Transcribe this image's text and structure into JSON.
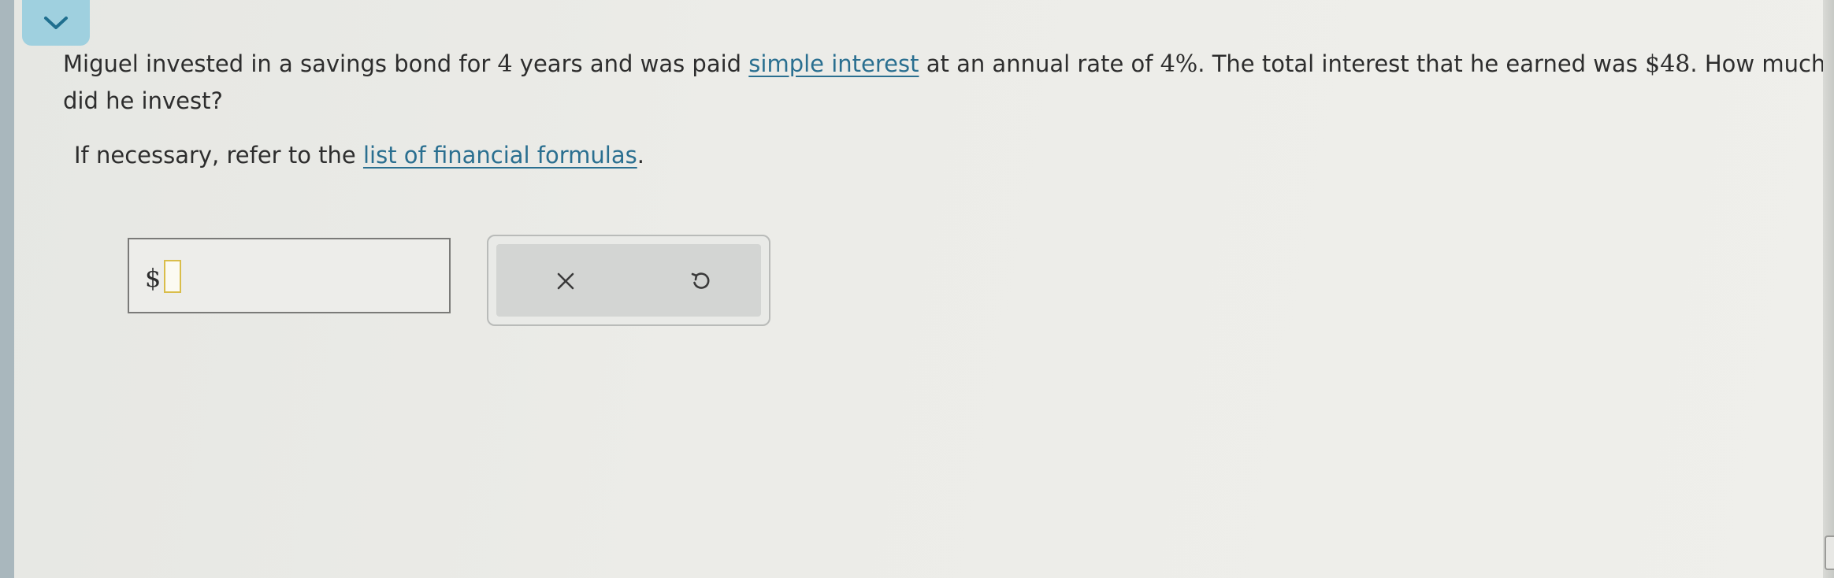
{
  "question": {
    "part1": "Miguel invested in a savings bond for ",
    "years": "4",
    "part2": " years and was paid ",
    "link_text": "simple interest",
    "part3": " at an annual rate of ",
    "rate": "4%",
    "part4": ". The total interest that he earned was ",
    "interest": "$48",
    "part5": ". How much did he invest?"
  },
  "reference": {
    "prefix": "If necessary, refer to the ",
    "link_text": "list of financial formulas",
    "suffix": "."
  },
  "answer": {
    "currency_symbol": "$",
    "value": ""
  },
  "actions": {
    "clear_icon": "x-icon",
    "reset_icon": "undo-icon"
  },
  "colors": {
    "tab_accent": "#9fd0df",
    "link": "#2a6f90",
    "input_border": "#d9bd4a"
  }
}
